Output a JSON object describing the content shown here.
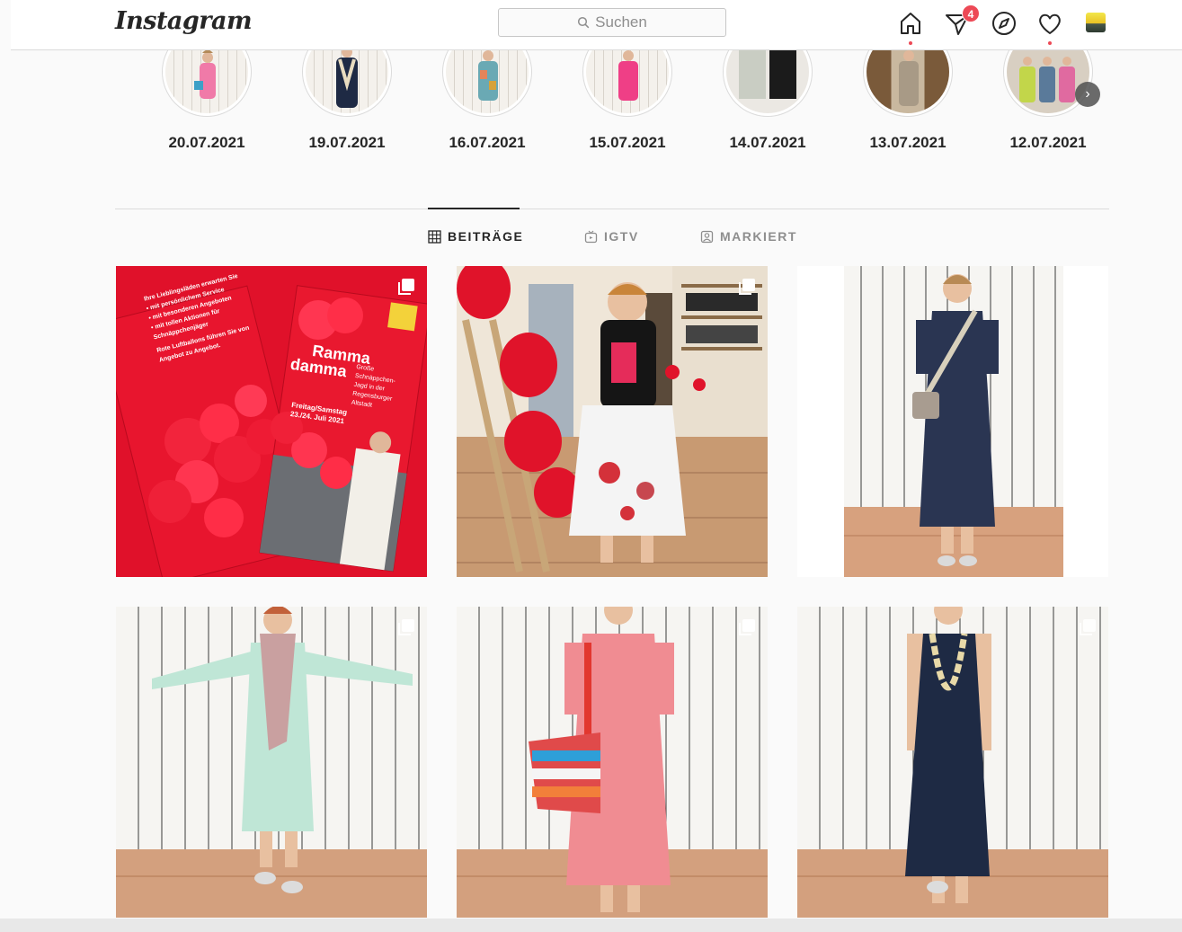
{
  "nav": {
    "logo": "Instagram",
    "search_placeholder": "Suchen",
    "direct_badge": "4"
  },
  "highlights": [
    {
      "date": "20.07.2021"
    },
    {
      "date": "19.07.2021"
    },
    {
      "date": "16.07.2021"
    },
    {
      "date": "15.07.2021"
    },
    {
      "date": "14.07.2021"
    },
    {
      "date": "13.07.2021"
    },
    {
      "date": "12.07.2021"
    }
  ],
  "tabs": [
    {
      "label": "BEITRÄGE",
      "active": true
    },
    {
      "label": "IGTV",
      "active": false
    },
    {
      "label": "MARKIERT",
      "active": false
    }
  ],
  "posts": {
    "flyer": {
      "left_lines": [
        "Ihre Lieblingsläden erwarten Sie",
        "• mit persönlichem Service",
        "• mit besonderen Angeboten",
        "• mit tollen Aktionen für",
        "Schnäppchenjäger",
        "Rote Luftballons führen Sie von",
        "Angebot zu Angebot."
      ],
      "title_line1": "Ramma",
      "title_line2": "damma",
      "sub_lines": [
        "Große",
        "Schnäppchen-",
        "Jagd in der",
        "Regensburger",
        "Altstadt"
      ],
      "date_line1": "Freitag/Samstag",
      "date_line2": "23./24. Juli 2021"
    }
  },
  "colors": {
    "accent_red": "#ed4956",
    "text": "#262626",
    "muted": "#8e8e8e",
    "border": "#dbdbdb"
  }
}
